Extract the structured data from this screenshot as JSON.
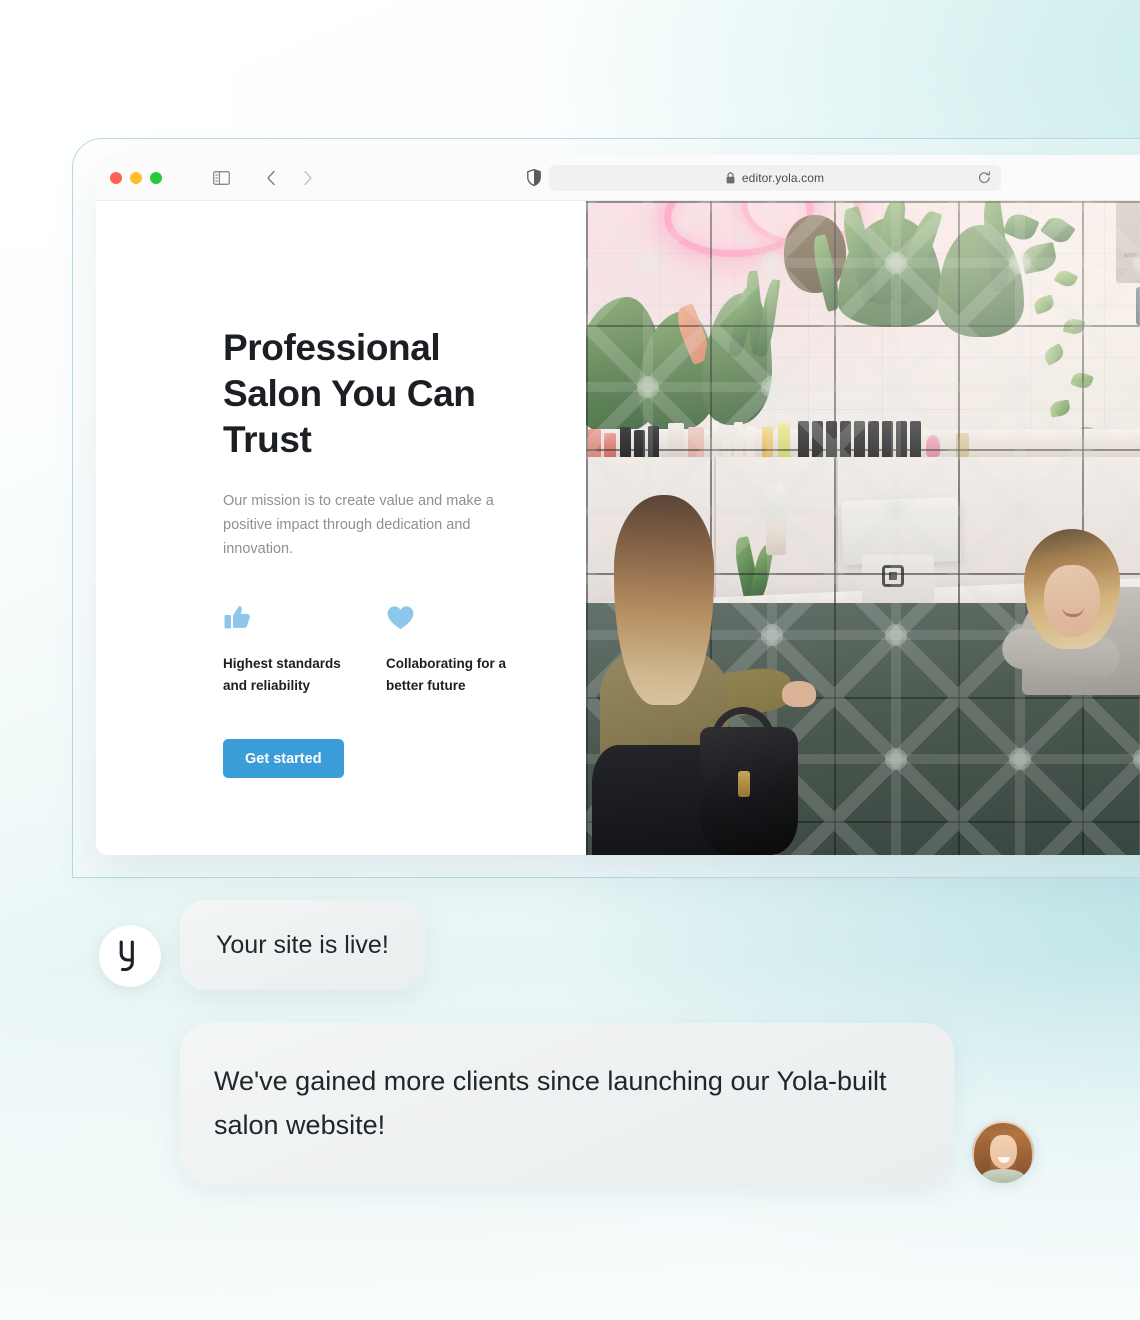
{
  "browser": {
    "url": "editor.yola.com",
    "lock_icon": "lock-icon",
    "reload_icon": "reload-icon",
    "sidebar_icon": "sidebar-toggle-icon",
    "back_icon": "chevron-left-icon",
    "forward_icon": "chevron-right-icon",
    "shield_icon": "shield-icon",
    "traffic_lights": [
      {
        "name": "close",
        "color": "#ff5f56"
      },
      {
        "name": "minimize",
        "color": "#ffbd2e"
      },
      {
        "name": "maximize",
        "color": "#28c840"
      }
    ]
  },
  "site": {
    "heading": "Professional Salon You Can Trust",
    "paragraph": "Our mission is to create value and make a positive impact through dedication and innovation.",
    "features": [
      {
        "icon": "thumbs-up-icon",
        "label": "Highest standards and reliability"
      },
      {
        "icon": "heart-icon",
        "label": "Collaborating for a better future"
      }
    ],
    "cta_label": "Get started",
    "hero_image_alt": "Salon front desk with stylist greeting a client"
  },
  "chat": {
    "brand_logo_letter": "y",
    "messages": [
      {
        "from": "yola",
        "text": "Your site is live!"
      },
      {
        "from": "customer",
        "text": "We've gained more clients since launching our Yola-built salon website!"
      }
    ],
    "customer_avatar": "customer-avatar-photo"
  },
  "colors": {
    "accent_blue": "#3b9dd8",
    "icon_blue": "#8dc8ec",
    "heading": "#1b1f23",
    "body_text": "#8c9196",
    "bubble_bg": "#f0f3f3",
    "frame_border": "#b8d9e8"
  }
}
